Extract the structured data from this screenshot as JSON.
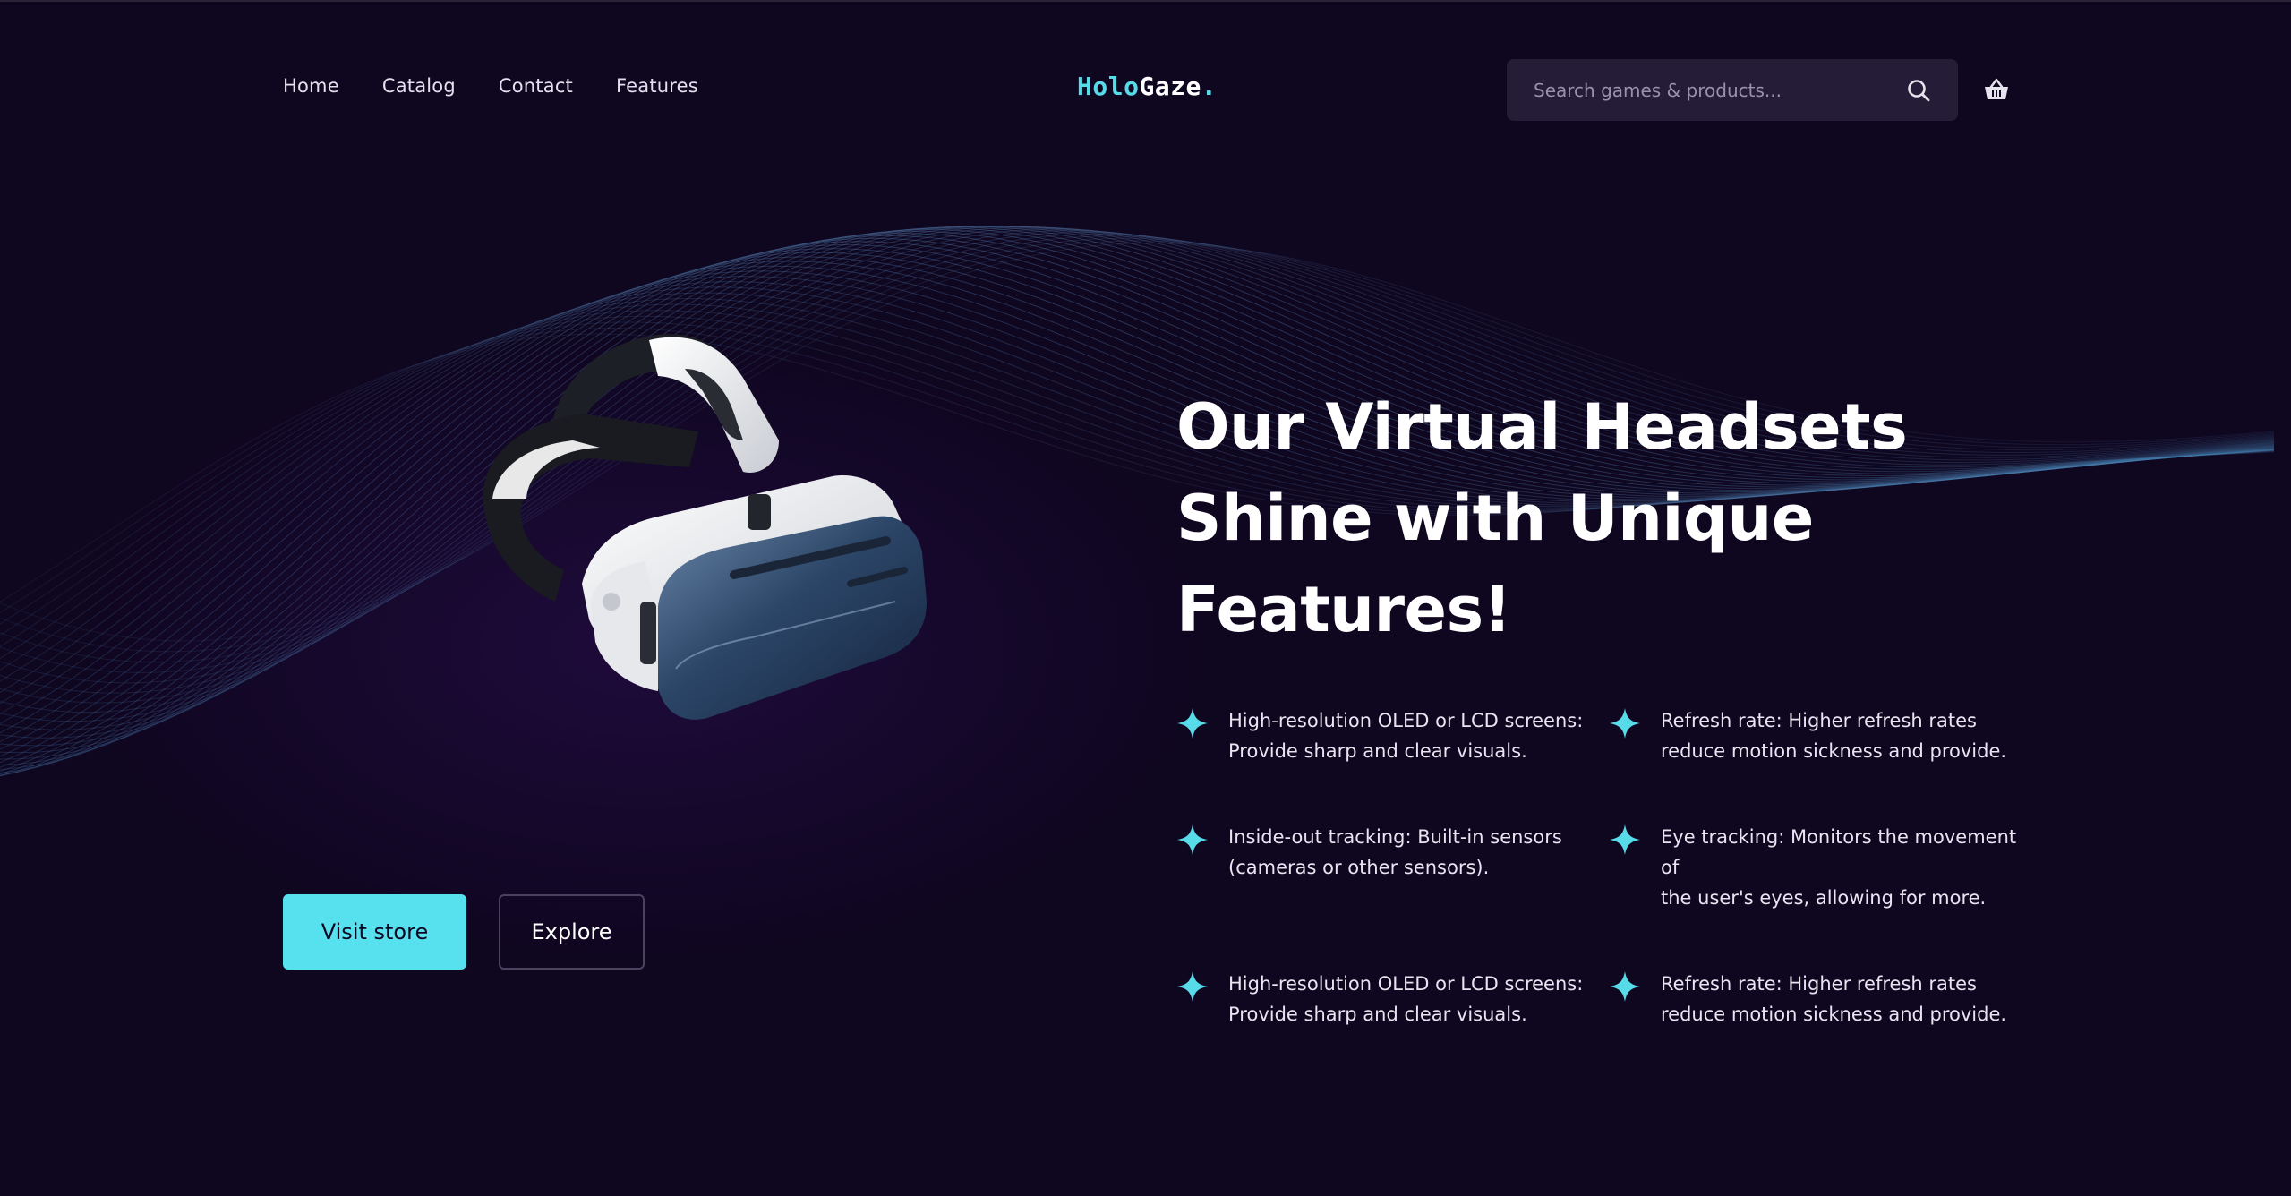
{
  "header": {
    "nav": [
      "Home",
      "Catalog",
      "Contact",
      "Features"
    ],
    "logo": {
      "part1": "Holo",
      "part2": "Gaze",
      "part3": "."
    },
    "search": {
      "placeholder": "Search games & products..."
    },
    "icons": {
      "search": "search-icon",
      "cart": "basket-icon"
    }
  },
  "hero": {
    "title_lines": [
      "Our Virtual Headsets",
      "Shine with Unique",
      "Features!"
    ],
    "product_image": "vr-headset",
    "features": [
      {
        "line1": "High-resolution OLED or LCD screens:",
        "line2": "Provide sharp and clear visuals."
      },
      {
        "line1": "Refresh rate: Higher refresh rates",
        "line2": "reduce motion sickness and provide."
      },
      {
        "line1": "Inside-out tracking: Built-in sensors",
        "line2": "(cameras or other sensors)."
      },
      {
        "line1": "Eye tracking: Monitors the movement of",
        "line2": "the user's eyes, allowing for more."
      },
      {
        "line1": "High-resolution OLED or LCD screens:",
        "line2": "Provide sharp and clear visuals."
      },
      {
        "line1": "Refresh rate: Higher refresh rates",
        "line2": "reduce motion sickness and provide."
      }
    ],
    "buttons": {
      "primary": "Visit store",
      "secondary": "Explore"
    }
  },
  "colors": {
    "background": "#0f0620",
    "accent": "#57dbe8",
    "search_bg": "#251c37"
  }
}
